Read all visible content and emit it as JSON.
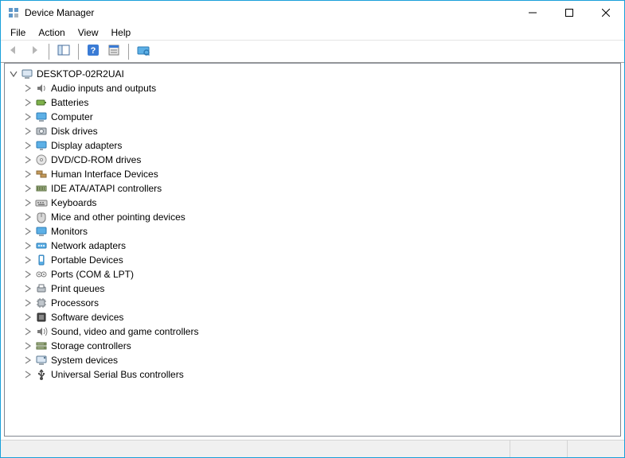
{
  "window": {
    "title": "Device Manager"
  },
  "menubar": {
    "file": "File",
    "action": "Action",
    "view": "View",
    "help": "Help"
  },
  "toolbar": {
    "back": "Back",
    "forward": "Forward",
    "show_hide_tree": "Show/Hide Console Tree",
    "help": "Help",
    "properties": "Properties",
    "scan": "Scan for hardware changes"
  },
  "tree": {
    "root": "DESKTOP-02R2UAI",
    "categories": [
      {
        "icon": "audio",
        "label": "Audio inputs and outputs"
      },
      {
        "icon": "battery",
        "label": "Batteries"
      },
      {
        "icon": "computer",
        "label": "Computer"
      },
      {
        "icon": "disk",
        "label": "Disk drives"
      },
      {
        "icon": "display",
        "label": "Display adapters"
      },
      {
        "icon": "dvd",
        "label": "DVD/CD-ROM drives"
      },
      {
        "icon": "hid",
        "label": "Human Interface Devices"
      },
      {
        "icon": "ide",
        "label": "IDE ATA/ATAPI controllers"
      },
      {
        "icon": "keyboard",
        "label": "Keyboards"
      },
      {
        "icon": "mouse",
        "label": "Mice and other pointing devices"
      },
      {
        "icon": "monitor",
        "label": "Monitors"
      },
      {
        "icon": "network",
        "label": "Network adapters"
      },
      {
        "icon": "portable",
        "label": "Portable Devices"
      },
      {
        "icon": "port",
        "label": "Ports (COM & LPT)"
      },
      {
        "icon": "printq",
        "label": "Print queues"
      },
      {
        "icon": "cpu",
        "label": "Processors"
      },
      {
        "icon": "software",
        "label": "Software devices"
      },
      {
        "icon": "sound",
        "label": "Sound, video and game controllers"
      },
      {
        "icon": "storage",
        "label": "Storage controllers"
      },
      {
        "icon": "system",
        "label": "System devices"
      },
      {
        "icon": "usb",
        "label": "Universal Serial Bus controllers"
      }
    ]
  }
}
